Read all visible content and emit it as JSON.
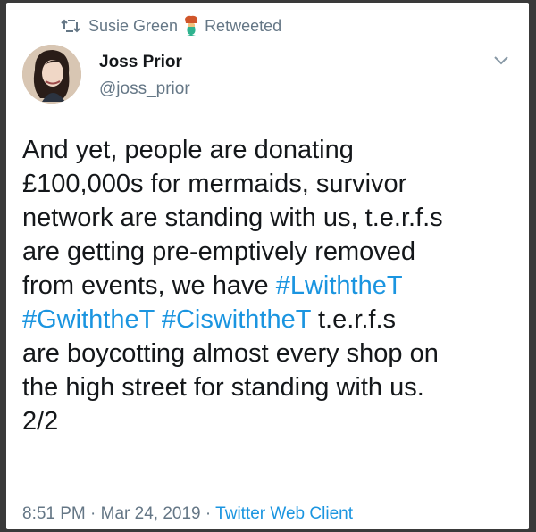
{
  "retweet": {
    "user": "Susie Green",
    "emoji": "mermaid-icon",
    "label": "Retweeted"
  },
  "author": {
    "display_name": "Joss Prior",
    "handle": "@joss_prior"
  },
  "tweet": {
    "lines": [
      [
        {
          "t": "And yet, people are donating"
        }
      ],
      [
        {
          "t": "£100,000s for mermaids, survivor"
        }
      ],
      [
        {
          "t": "network are standing with us, t.e.r.f.s"
        }
      ],
      [
        {
          "t": "are getting pre-emptively removed"
        }
      ],
      [
        {
          "t": "from events, we have "
        },
        {
          "t": "#LwiththeT",
          "tag": true
        }
      ],
      [
        {
          "t": "#GwiththeT",
          "tag": true
        },
        {
          "t": " "
        },
        {
          "t": "#CiswiththeT",
          "tag": true
        },
        {
          "t": "  t.e.r.f.s"
        }
      ],
      [
        {
          "t": "are boycotting almost every shop on"
        }
      ],
      [
        {
          "t": "the high street for standing with us."
        }
      ],
      [
        {
          "t": "2/2"
        }
      ]
    ]
  },
  "meta": {
    "time": "8:51 PM",
    "sep1": " · ",
    "date": "Mar 24, 2019",
    "sep2": " · ",
    "client": "Twitter Web Client"
  },
  "colors": {
    "link": "#1b95e0",
    "secondary": "#657786",
    "text": "#14171a"
  }
}
